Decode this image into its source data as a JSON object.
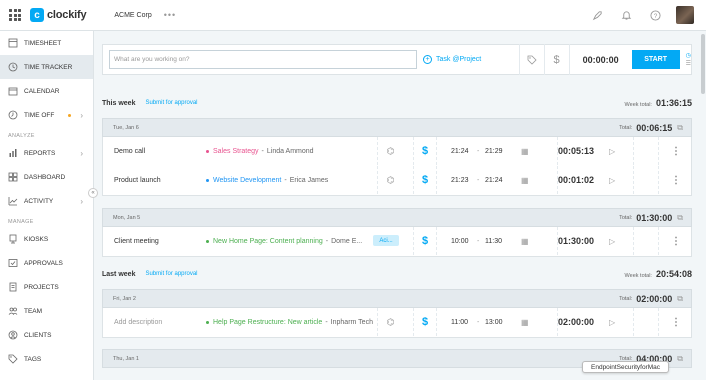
{
  "app": {
    "name": "clockify",
    "workspace": "ACME Corp"
  },
  "sidebar": {
    "items": [
      {
        "label": "TIMESHEET",
        "icon": "timesheet-icon"
      },
      {
        "label": "TIME TRACKER",
        "icon": "clock-icon",
        "active": true
      },
      {
        "label": "CALENDAR",
        "icon": "calendar-icon"
      },
      {
        "label": "TIME OFF",
        "icon": "time-off-icon"
      }
    ],
    "analyze_label": "ANALYZE",
    "analyze_items": [
      {
        "label": "REPORTS",
        "icon": "reports-icon"
      },
      {
        "label": "DASHBOARD",
        "icon": "dashboard-icon"
      },
      {
        "label": "ACTIVITY",
        "icon": "activity-icon"
      }
    ],
    "manage_label": "MANAGE",
    "manage_items": [
      {
        "label": "KIOSKS",
        "icon": "kiosks-icon"
      },
      {
        "label": "APPROVALS",
        "icon": "approvals-icon"
      },
      {
        "label": "PROJECTS",
        "icon": "projects-icon"
      },
      {
        "label": "TEAM",
        "icon": "team-icon"
      },
      {
        "label": "CLIENTS",
        "icon": "clients-icon"
      },
      {
        "label": "TAGS",
        "icon": "tags-icon"
      }
    ]
  },
  "timer": {
    "placeholder": "What are you working on?",
    "project_label": "Task @Project",
    "time": "00:00:00",
    "start_label": "START"
  },
  "weeks": [
    {
      "title": "This week",
      "submit": "Submit for approval",
      "total_label": "Week total:",
      "total": "01:36:15"
    },
    {
      "title": "Last week",
      "submit": "Submit for approval",
      "total_label": "Week total:",
      "total": "20:54:08"
    }
  ],
  "days": [
    {
      "label": "Tue, Jan 6",
      "total_label": "Total:",
      "total": "00:06:15"
    },
    {
      "label": "Mon, Jan 5",
      "total_label": "Total:",
      "total": "01:30:00"
    },
    {
      "label": "Fri, Jan 2",
      "total_label": "Total:",
      "total": "02:00:00"
    },
    {
      "label": "Thu, Jan 1",
      "total_label": "Total:",
      "total": "04:00:00"
    }
  ],
  "entries": [
    {
      "description": "Demo call",
      "project": "Sales Strategy",
      "client": "Linda Ammond",
      "project_color": "#e8538f",
      "start": "21:24",
      "end": "21:29",
      "duration": "00:05:13"
    },
    {
      "description": "Product launch",
      "project": "Website Development",
      "client": "Erica James",
      "project_color": "#2196f3",
      "start": "21:23",
      "end": "21:24",
      "duration": "00:01:02"
    },
    {
      "description": "Client meeting",
      "project": "New Home Page: Content planning",
      "client": "Dome E...",
      "project_color": "#4caf50",
      "tag": "Aci...",
      "start": "10:00",
      "end": "11:30",
      "duration": "01:30:00"
    },
    {
      "description": "Add description",
      "project": "Help Page Restructure: New article",
      "client": "Inpharm Tech",
      "project_color": "#4caf50",
      "start": "11:00",
      "end": "13:00",
      "duration": "02:00:00"
    }
  ],
  "toast": "EndpointSecurityforMac",
  "colors": {
    "accent": "#03a9f4",
    "active_nav": "#e4eaee",
    "time_off_dot": "#f5a623"
  }
}
